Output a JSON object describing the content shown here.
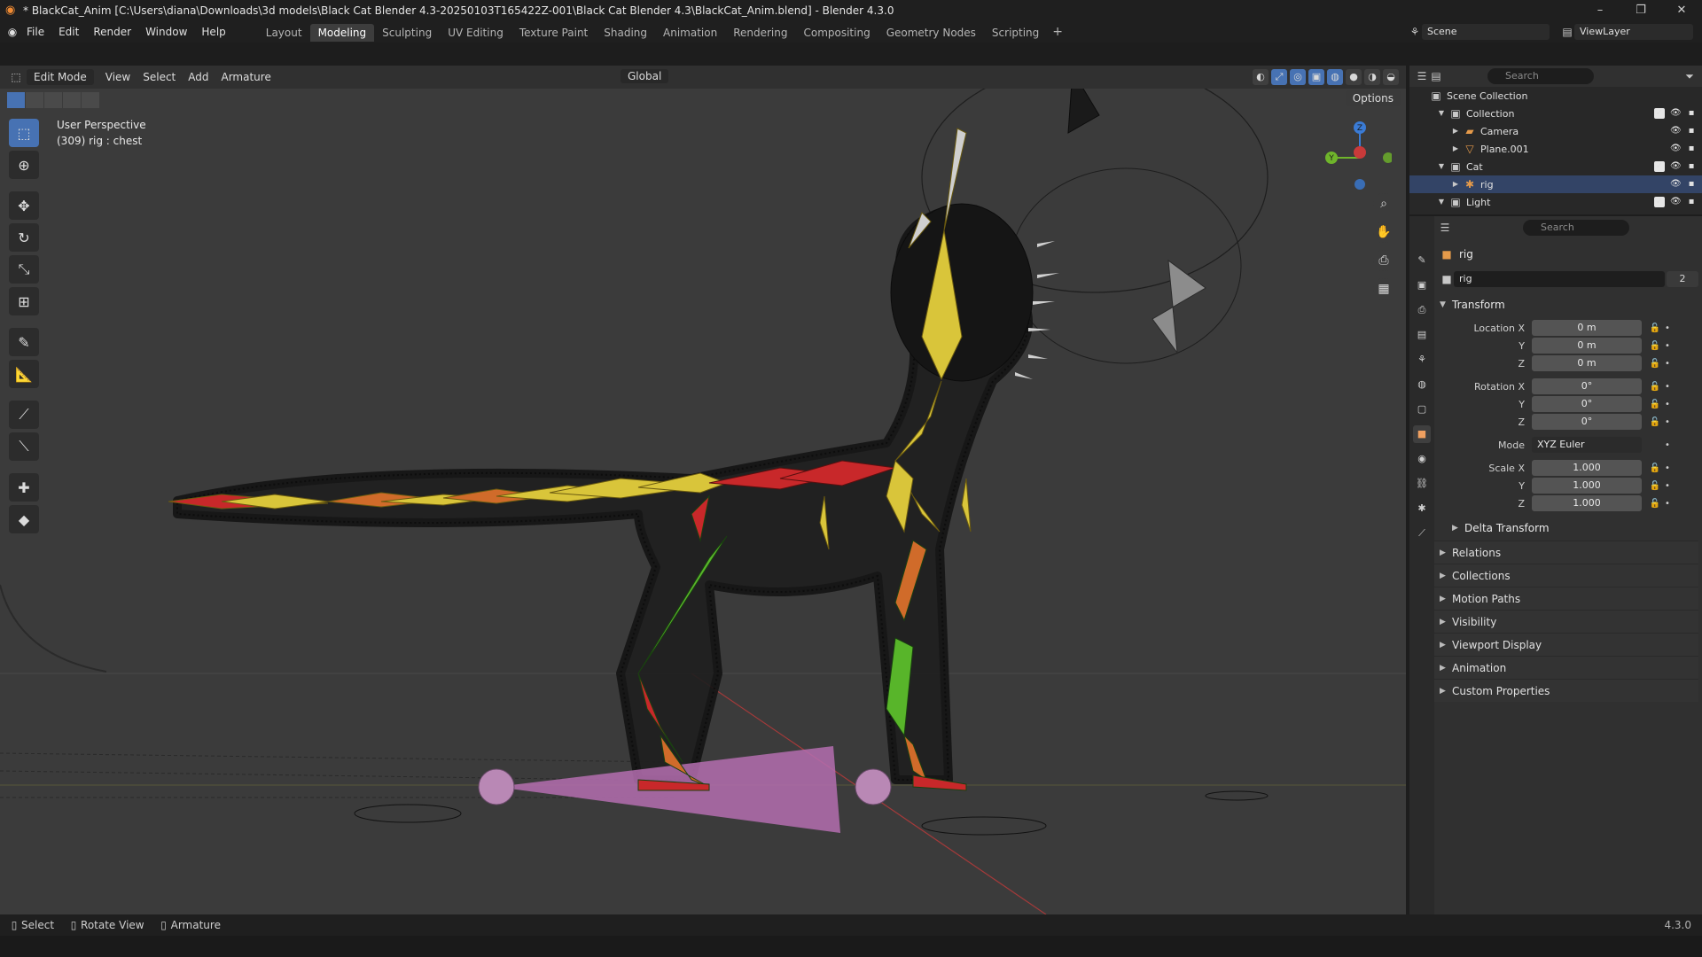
{
  "titlebar": {
    "title": "* BlackCat_Anim [C:\\Users\\diana\\Downloads\\3d models\\Black Cat Blender 4.3-20250103T165422Z-001\\Black Cat Blender 4.3\\BlackCat_Anim.blend] - Blender 4.3.0",
    "minimize": "–",
    "maximize": "❐",
    "close": "✕"
  },
  "menu": {
    "items": [
      "File",
      "Edit",
      "Render",
      "Window",
      "Help"
    ],
    "workspaces": [
      "Layout",
      "Modeling",
      "Sculpting",
      "UV Editing",
      "Texture Paint",
      "Shading",
      "Animation",
      "Rendering",
      "Compositing",
      "Geometry Nodes",
      "Scripting"
    ],
    "active_workspace": "Modeling",
    "add_tab": "+",
    "scene": "Scene",
    "view_layer": "ViewLayer"
  },
  "viewport_header": {
    "mode": "Edit Mode",
    "menus": [
      "View",
      "Select",
      "Add",
      "Armature"
    ],
    "orientation": "Global",
    "options": "Options"
  },
  "viewport_overlay": {
    "perspective": "User Perspective",
    "selection": "(309) rig : chest"
  },
  "gizmo": {
    "z": "Z",
    "y": "Y"
  },
  "outliner": {
    "search_placeholder": "Search",
    "rows": [
      {
        "label": "Scene Collection",
        "indent": 0
      },
      {
        "label": "Collection",
        "indent": 1
      },
      {
        "label": "Camera",
        "indent": 2
      },
      {
        "label": "Plane.001",
        "indent": 2
      },
      {
        "label": "Cat",
        "indent": 1
      },
      {
        "label": "rig",
        "indent": 2
      },
      {
        "label": "Light",
        "indent": 1
      }
    ]
  },
  "properties": {
    "search_placeholder": "Search",
    "object_name": "rig",
    "data_name": "rig",
    "users": "2",
    "transform_title": "Transform",
    "location_label": "Location X",
    "rotation_label": "Rotation X",
    "scale_label": "Scale X",
    "y_label": "Y",
    "z_label": "Z",
    "location": [
      "0 m",
      "0 m",
      "0 m"
    ],
    "rotation": [
      "0°",
      "0°",
      "0°"
    ],
    "mode_label": "Mode",
    "mode_value": "XYZ Euler",
    "scale": [
      "1.000",
      "1.000",
      "1.000"
    ],
    "delta_transform": "Delta Transform",
    "sections": [
      "Relations",
      "Collections",
      "Motion Paths",
      "Visibility",
      "Viewport Display",
      "Animation",
      "Custom Properties"
    ]
  },
  "statusbar": {
    "select": "Select",
    "rotate": "Rotate View",
    "armature": "Armature",
    "version": "4.3.0"
  },
  "colors": {
    "accent": "#4772b3",
    "bone_yellow": "#d9c53a",
    "bone_red": "#c8282a",
    "bone_green": "#58b52a",
    "bone_orange": "#d06b2a",
    "light_pink": "#b56fb0"
  }
}
